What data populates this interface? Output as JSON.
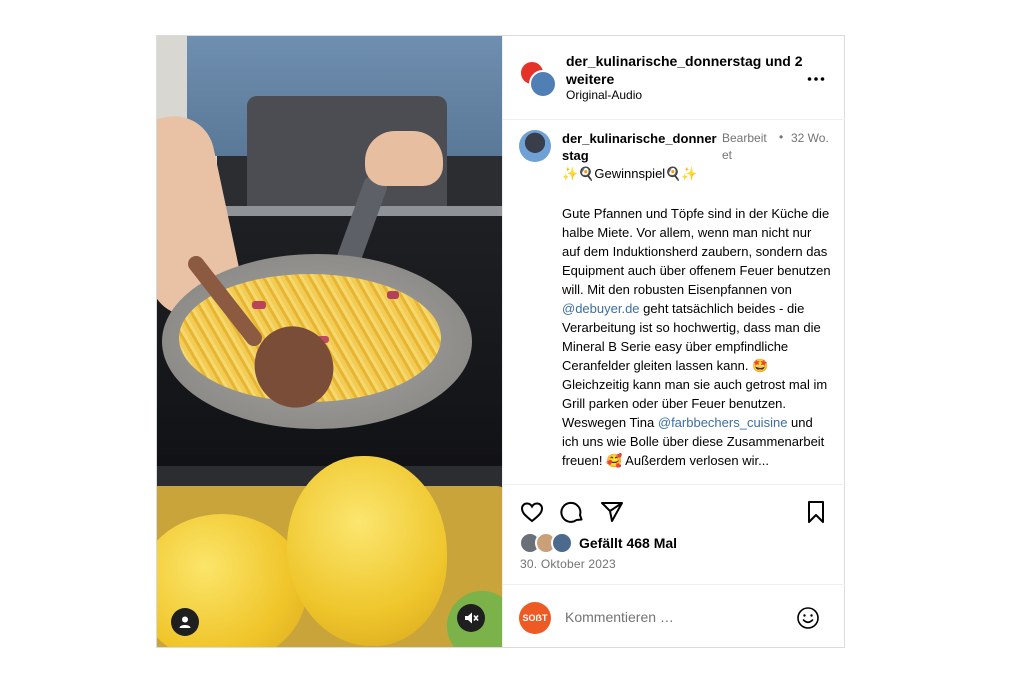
{
  "post": {
    "header": {
      "username": "der_kulinarische_donnerstag",
      "suffix": "und 2 weitere",
      "audio": "Original-Audio",
      "more_icon": "more-horizontal-icon"
    },
    "caption": {
      "username": "der_kulinarische_donnerstag",
      "edited": "Bearbeitet",
      "dot": "•",
      "time": "32 Wo.",
      "headline": "✨🍳Gewinnspiel🍳✨",
      "body_1": "Gute Pfannen und Töpfe sind in der Küche die halbe Miete. Vor allem, wenn man nicht nur auf dem Induktionsherd zaubern, sondern das Equipment auch über offenem Feuer benutzen will. Mit den robusten Eisenpfannen von ",
      "mention_1": "@debuyer.de",
      "body_2": " geht tatsächlich beides - die Verarbeitung ist so hochwertig, dass man die Mineral B Serie easy über empfindliche Ceranfelder gleiten lassen kann. 🤩 Gleichzeitig kann man sie auch getrost mal im Grill parken oder über Feuer benutzen. Weswegen Tina ",
      "mention_2": "@farbbechers_cuisine",
      "body_3": " und ich uns wie Bolle über diese Zusammenarbeit freuen! 🥰 Außerdem verlosen wir..."
    },
    "actions": {
      "likes": "Gefällt 468 Mal",
      "date": "30. Oktober 2023"
    },
    "comment": {
      "avatar_label": "SOẞT",
      "placeholder": "Kommentieren …"
    },
    "colors": {
      "accent_link": "#3b6ea5",
      "secondary_text": "#737373",
      "border": "#dbdbdb"
    }
  }
}
